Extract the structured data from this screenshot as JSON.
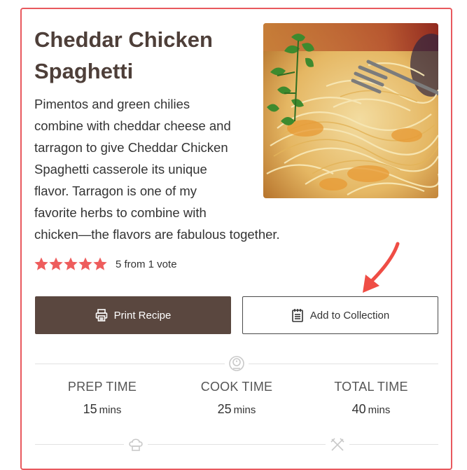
{
  "recipe": {
    "title_line1": "Cheddar Chicken",
    "title_line2": "Spaghetti",
    "summary_lines": [
      "Pimentos and green chilies",
      "combine with cheddar cheese and",
      "tarragon to give Cheddar Chicken",
      "Spaghetti casserole its unique",
      "flavor. Tarragon is one of my",
      "favorite herbs to combine with",
      "chicken—the flavors are fabulous together."
    ],
    "rating": {
      "value": 5,
      "max": 5,
      "text": "5 from 1 vote"
    }
  },
  "buttons": {
    "print_label": "Print Recipe",
    "collection_label": "Add to Collection"
  },
  "times": [
    {
      "label": "PREP TIME",
      "value": "15",
      "unit": "mins"
    },
    {
      "label": "COOK TIME",
      "value": "25",
      "unit": "mins"
    },
    {
      "label": "TOTAL TIME",
      "value": "40",
      "unit": "mins"
    }
  ],
  "icons": {
    "print": "printer-icon",
    "collection": "notepad-icon",
    "timer": "timer-icon",
    "chef": "chef-hat-icon",
    "utensils": "fork-knife-icon",
    "annotation": "red-arrow-icon"
  },
  "colors": {
    "card_border": "#e8595e",
    "title": "#4e3f39",
    "primary_button": "#5a473f",
    "star": "#ee5c5c",
    "annotation_arrow": "#ef4d45"
  }
}
